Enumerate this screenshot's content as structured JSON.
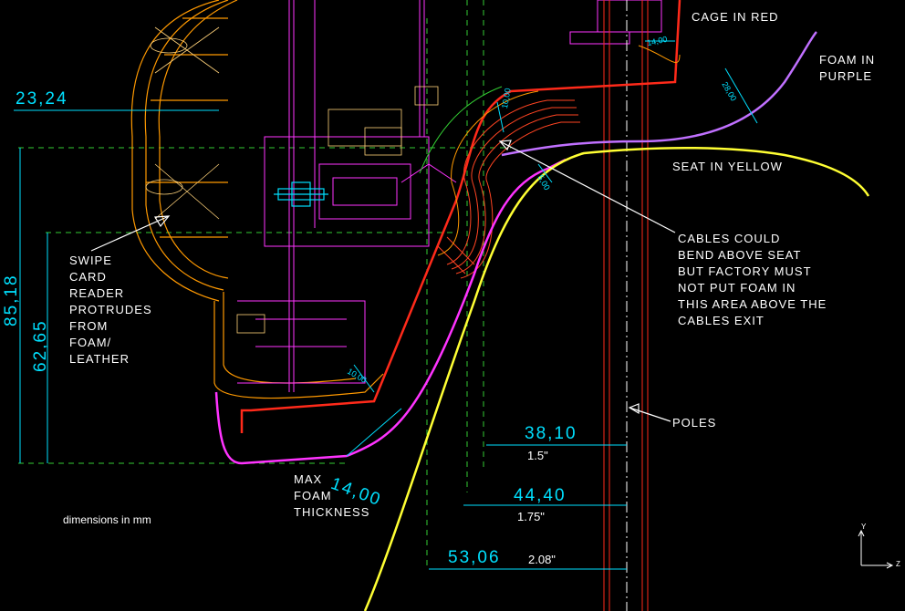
{
  "colors": {
    "cage": "#ff2a1a",
    "foam": "#c070ff",
    "seat": "#ffff33",
    "dimension": "#00e0ff",
    "magenta": "#ff33ff",
    "orange": "#ff9900",
    "green": "#33cc33",
    "background": "#000000"
  },
  "labels": {
    "cage": "CAGE IN RED",
    "foam": "FOAM IN\nPURPLE",
    "seat": "SEAT IN YELLOW",
    "cables": "CABLES COULD\nBEND ABOVE SEAT\nBUT FACTORY MUST\nNOT PUT FOAM IN\nTHIS AREA ABOVE THE\nCABLES EXIT",
    "poles": "POLES",
    "swipe": "SWIPE\nCARD\nREADER\nPROTRUDES\nFROM\nFOAM/\nLEATHER",
    "max_foam": "MAX\nFOAM\nTHICKNESS",
    "units_note": "dimensions in mm"
  },
  "dimensions": {
    "d1": "23,24",
    "d2": "85,18",
    "d3": "62,65",
    "d4": "38,10",
    "d4_in": "1.5\"",
    "d5": "44,40",
    "d5_in": "1.75\"",
    "d6": "53,06",
    "d6_in": "2.08\"",
    "d7": "14,00",
    "small1": "14,00",
    "small2": "28,00",
    "small3": "10,00",
    "small4": "10,00",
    "small5": "5,00"
  },
  "axis": {
    "y": "Y",
    "z": "Z"
  }
}
